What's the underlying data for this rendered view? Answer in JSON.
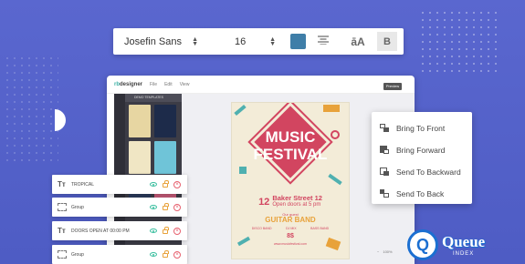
{
  "toolbar": {
    "font_family": "Josefin Sans",
    "font_size": "16",
    "color_swatch": "#3f7ea8",
    "align_icon": "align-center-icon",
    "case_label": "āA",
    "bold_label": "B"
  },
  "app": {
    "logo_main": "designer",
    "logo_prefix": "rb",
    "menu": [
      "File",
      "Edit",
      "View"
    ],
    "templates_header": "DEMO TEMPLATES",
    "preview_label": "Preview"
  },
  "poster": {
    "title_line1": "MUSIC",
    "title_line2": "FESTIVAL",
    "day": "12",
    "address": "Baker Street 12",
    "open_text": "Open doors at 5 pm",
    "guest_label": "Our guest",
    "band": "GUITAR BAND",
    "genres": [
      "DISCO BAND",
      "DJ MIX",
      "BASS BAND"
    ],
    "price": "8$",
    "website": "www.musicfestival.com",
    "colors": {
      "accent": "#d24560",
      "background": "#f3ecd8",
      "teal": "#4fb0b0",
      "yellow": "#e8a23a"
    }
  },
  "context_menu": {
    "items": [
      {
        "label": "Bring To Front",
        "icon": "bring-to-front-icon"
      },
      {
        "label": "Bring Forward",
        "icon": "bring-forward-icon"
      },
      {
        "label": "Send To Backward",
        "icon": "send-backward-icon"
      },
      {
        "label": "Send To Back",
        "icon": "send-to-back-icon"
      }
    ]
  },
  "layers": {
    "items": [
      {
        "type": "Tт",
        "name": "TROPICAL"
      },
      {
        "type": "group",
        "name": "Group"
      },
      {
        "type": "Tт",
        "name": "DOORS OPEN AT 00:00 PM"
      },
      {
        "type": "group",
        "name": "Group"
      }
    ]
  },
  "zoom": {
    "value": "100%"
  },
  "brand": {
    "name": "Queue",
    "subtitle": "INDEX",
    "color": "#1b6fd1"
  }
}
